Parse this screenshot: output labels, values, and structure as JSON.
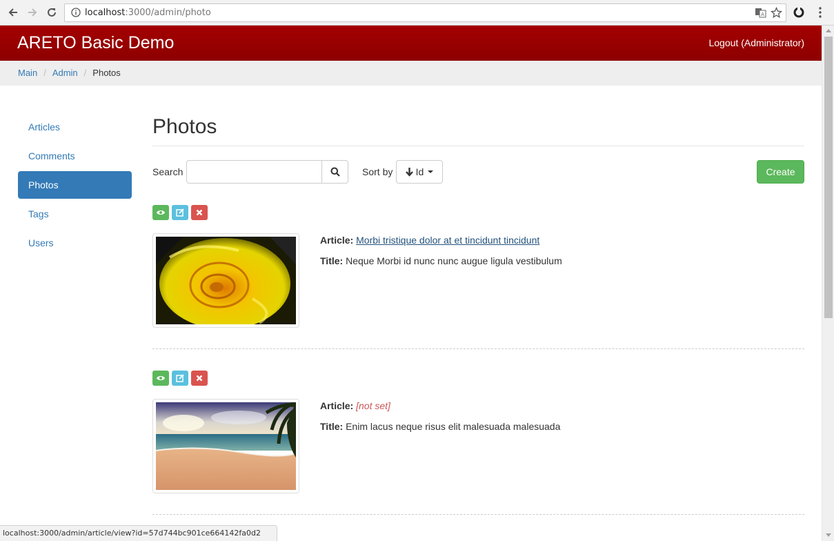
{
  "browser": {
    "url_host": "localhost",
    "url_rest": ":3000/admin/photo",
    "status_url": "localhost:3000/admin/article/view?id=57d744bc901ce664142fa0d2"
  },
  "navbar": {
    "brand": "ARETO Basic Demo",
    "logout_label": "Logout (Administrator)",
    "color": "#9b0000"
  },
  "breadcrumb": {
    "items": [
      "Main",
      "Admin"
    ],
    "active": "Photos"
  },
  "sidebar": {
    "items": [
      {
        "label": "Articles"
      },
      {
        "label": "Comments"
      },
      {
        "label": "Photos"
      },
      {
        "label": "Tags"
      },
      {
        "label": "Users"
      }
    ],
    "active_index": 2
  },
  "main": {
    "title": "Photos",
    "search_label": "Search",
    "search_value": "",
    "sort_label": "Sort by",
    "sort_value": "Id",
    "create_label": "Create"
  },
  "records": [
    {
      "image": "yellow-rose",
      "article_label": "Article:",
      "article_value": "Morbi tristique dolor at et tincidunt tincidunt",
      "title_label": "Title:",
      "title_value": "Neque Morbi id nunc nunc augue ligula vestibulum"
    },
    {
      "image": "tropical-beach",
      "article_label": "Article:",
      "article_value": "[not set]",
      "title_label": "Title:",
      "title_value": "Enim lacus neque risus elit malesuada malesuada"
    }
  ]
}
